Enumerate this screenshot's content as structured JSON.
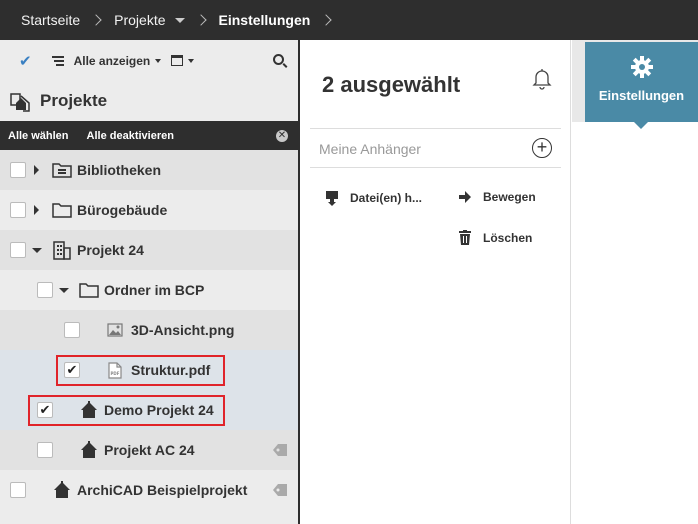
{
  "breadcrumb": {
    "items": [
      "Startseite",
      "Projekte",
      "Einstellungen"
    ]
  },
  "toolbar": {
    "filter_label": "Alle anzeigen",
    "accent_color": "#3a80c2"
  },
  "panel": {
    "title": "Projekte"
  },
  "selection_bar": {
    "select_all": "Alle wählen",
    "deselect_all": "Alle deaktivieren"
  },
  "tree": {
    "items": [
      {
        "label": "Bibliotheken",
        "icon": "library-folder-icon",
        "checked": false
      },
      {
        "label": "Bürogebäude",
        "icon": "folder-icon",
        "checked": false
      },
      {
        "label": "Projekt 24",
        "icon": "building-icon",
        "checked": false
      },
      {
        "label": "Ordner im BCP",
        "icon": "folder-icon",
        "checked": false
      },
      {
        "label": "3D-Ansicht.png",
        "icon": "image-file-icon",
        "checked": false
      },
      {
        "label": "Struktur.pdf",
        "icon": "pdf-file-icon",
        "checked": true
      },
      {
        "label": "Demo Projekt 24",
        "icon": "project-house-icon",
        "checked": true
      },
      {
        "label": "Projekt AC 24",
        "icon": "project-house-icon",
        "checked": false
      },
      {
        "label": "ArchiCAD Beispielprojekt",
        "icon": "project-house-icon",
        "checked": false
      }
    ]
  },
  "selection": {
    "title": "2 ausgewählt",
    "followers_placeholder": "Meine Anhänger",
    "actions": {
      "download": "Datei(en) h...",
      "move": "Bewegen",
      "delete": "Löschen"
    }
  },
  "settings": {
    "label": "Einstellungen",
    "color": "#4a8aa6"
  }
}
